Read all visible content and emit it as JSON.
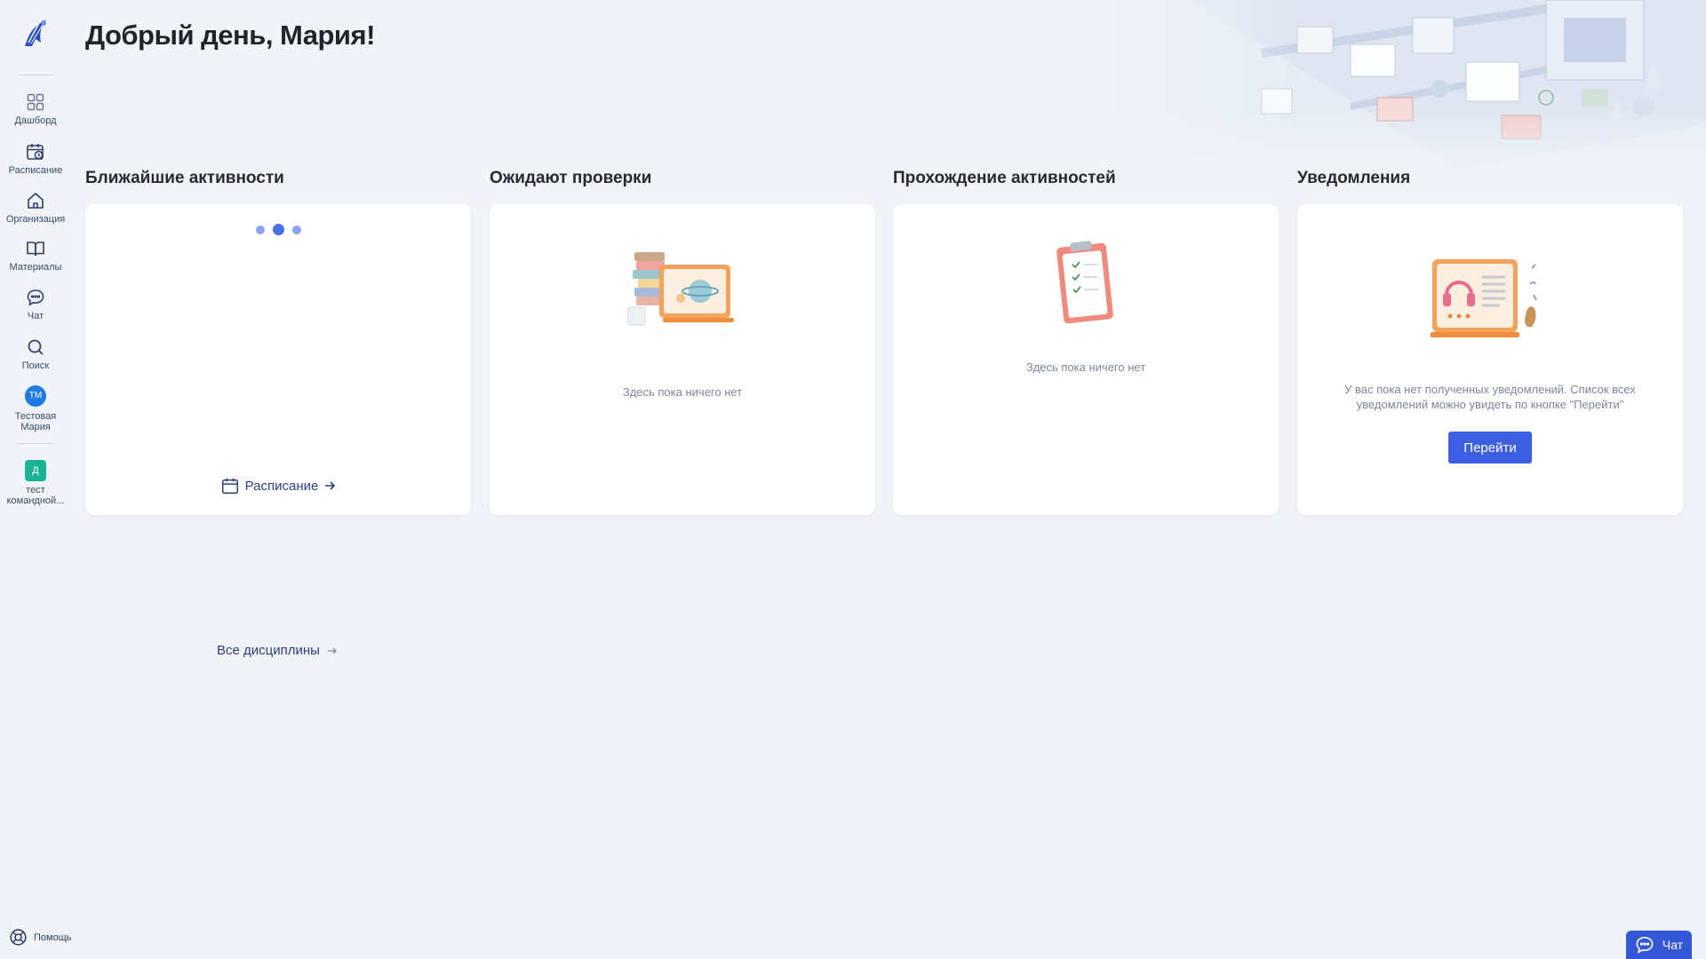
{
  "sidebar": {
    "items": [
      {
        "label": "Дашборд",
        "icon": "dashboard-icon"
      },
      {
        "label": "Расписание",
        "icon": "calendar-clock-icon"
      },
      {
        "label": "Организация",
        "icon": "home-icon"
      },
      {
        "label": "Материалы",
        "icon": "book-icon"
      },
      {
        "label": "Чат",
        "icon": "chat-icon"
      },
      {
        "label": "Поиск",
        "icon": "search-icon"
      }
    ],
    "user": {
      "initials": "ТМ",
      "name": "Тестовая Мария"
    },
    "team": {
      "initial": "Д",
      "name": "тест командной..."
    },
    "help_label": "Помощь"
  },
  "header": {
    "greeting": "Добрый день, Мария!"
  },
  "columns": {
    "upcoming": {
      "title": "Ближайшие активности",
      "schedule_link": "Расписание"
    },
    "review": {
      "title": "Ожидают проверки",
      "empty_text": "Здесь пока ничего нет"
    },
    "progress": {
      "title": "Прохождение активностей",
      "empty_text": "Здесь пока ничего нет"
    },
    "notifications": {
      "title": "Уведомления",
      "text": "У вас пока нет полученных уведомлений. Список всех уведомлений можно увидеть по кнопке \"Перейти\"",
      "button": "Перейти"
    }
  },
  "all_disciplines_link": "Все дисциплины",
  "chat_button": "Чат",
  "colors": {
    "accent": "#3b5fe0",
    "background": "#f0f3f8",
    "avatar": "#1f7be0",
    "team_badge": "#1ab395"
  }
}
